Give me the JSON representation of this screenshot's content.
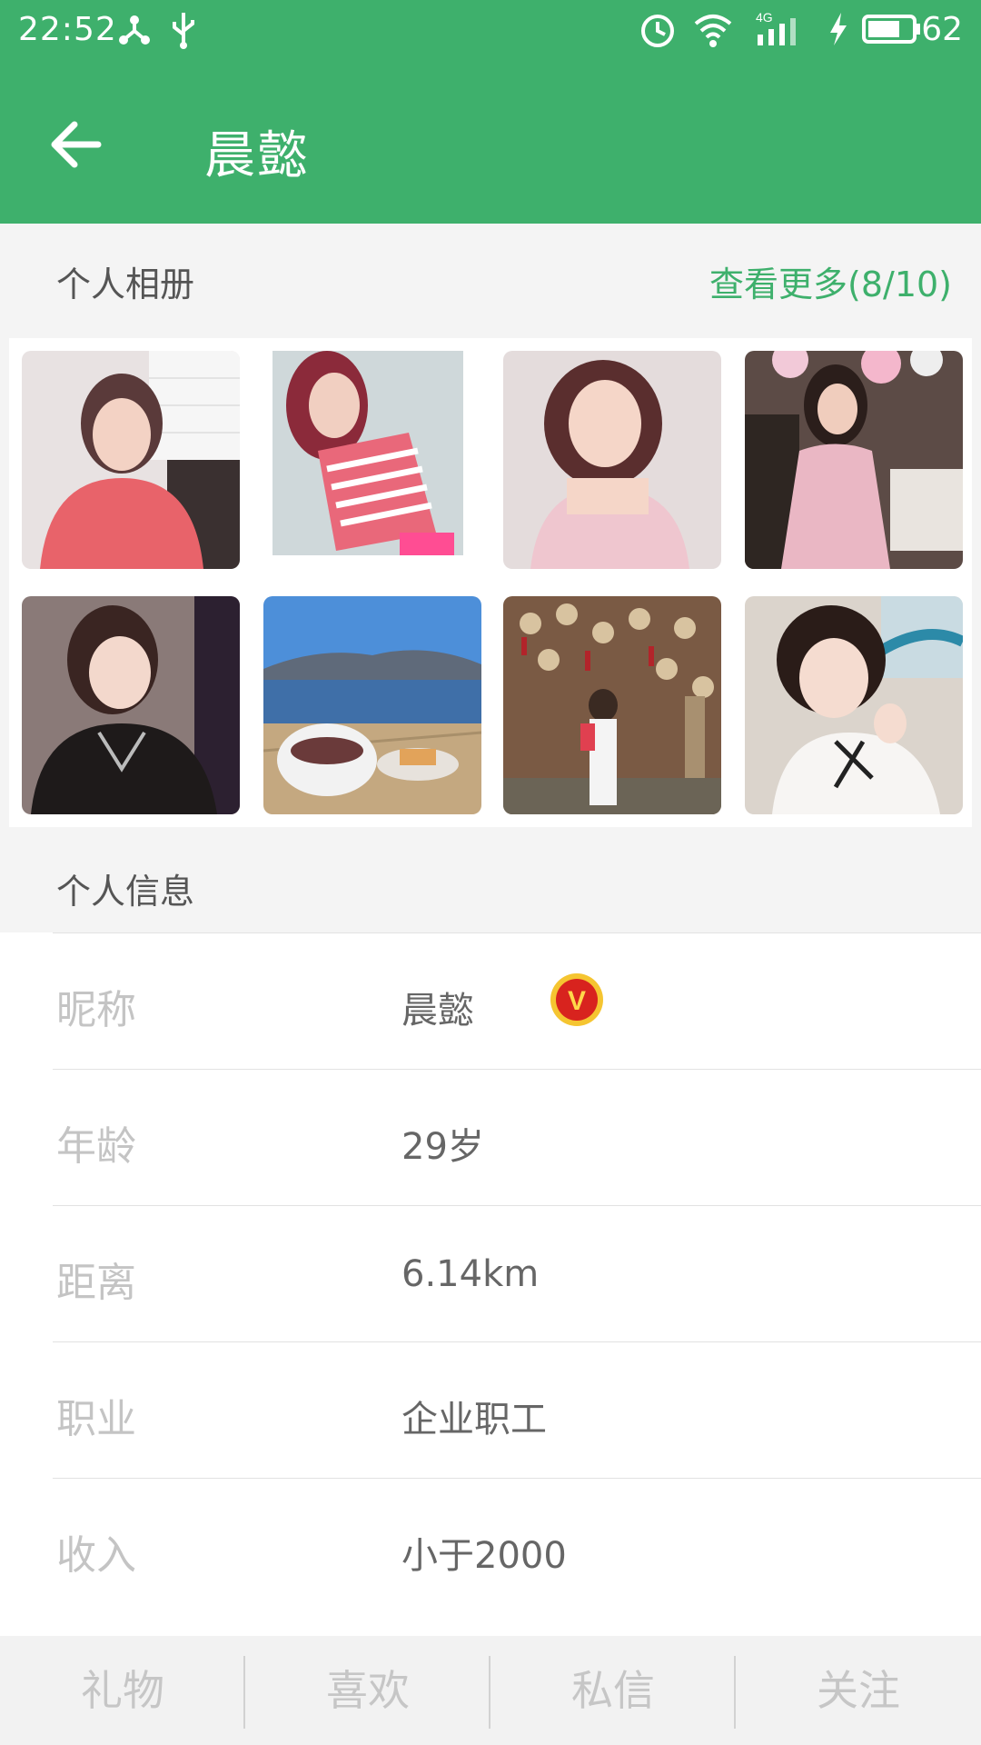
{
  "status_bar": {
    "time": "22:52",
    "battery": "62",
    "network": "4G",
    "icons": [
      "share-icon",
      "usb-icon",
      "alarm-icon",
      "wifi-icon",
      "signal-icon",
      "charging-icon",
      "battery-icon"
    ]
  },
  "header": {
    "title": "晨懿",
    "back_icon": "arrow-left-icon"
  },
  "album": {
    "title": "个人相册",
    "see_more": "查看更多(8/10)",
    "photos": [
      {
        "name": "photo-1"
      },
      {
        "name": "photo-2"
      },
      {
        "name": "photo-3"
      },
      {
        "name": "photo-4"
      },
      {
        "name": "photo-5"
      },
      {
        "name": "photo-6"
      },
      {
        "name": "photo-7"
      },
      {
        "name": "photo-8"
      }
    ]
  },
  "info": {
    "title": "个人信息",
    "rows": [
      {
        "label": "昵称",
        "value": "晨懿",
        "badge": "V"
      },
      {
        "label": "年龄",
        "value": "29岁"
      },
      {
        "label": "距离",
        "value": "6.14km"
      },
      {
        "label": "职业",
        "value": "企业职工"
      },
      {
        "label": "收入",
        "value": "小于2000"
      }
    ]
  },
  "bottom_bar": {
    "buttons": [
      "礼物",
      "喜欢",
      "私信",
      "关注"
    ]
  },
  "colors": {
    "primary": "#3eb06c",
    "background": "#f4f4f4",
    "label": "#c4c4c4",
    "value": "#666666"
  }
}
